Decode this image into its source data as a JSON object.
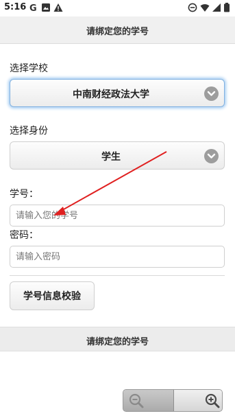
{
  "status_bar": {
    "time": "5:16",
    "left_icons": [
      "google-icon",
      "image-icon",
      "warning-icon"
    ],
    "right_icons": [
      "dnd-icon",
      "wifi-icon",
      "signal-icon",
      "battery-icon"
    ]
  },
  "header": {
    "title": "请绑定您的学号"
  },
  "school": {
    "label": "选择学校",
    "selected": "中南财经政法大学"
  },
  "identity": {
    "label": "选择身份",
    "selected": "学生"
  },
  "student_id": {
    "label": "学号：",
    "placeholder": "请输入您的学号",
    "value": ""
  },
  "password": {
    "label": "密码：",
    "placeholder": "请输入密码",
    "value": ""
  },
  "verify_button": {
    "label": "学号信息校验"
  },
  "footer": {
    "title": "请绑定您的学号"
  },
  "zoom_controls": {
    "out_icon": "zoom-out-icon",
    "in_icon": "zoom-in-icon"
  },
  "annotation": {
    "color": "#e02020"
  }
}
